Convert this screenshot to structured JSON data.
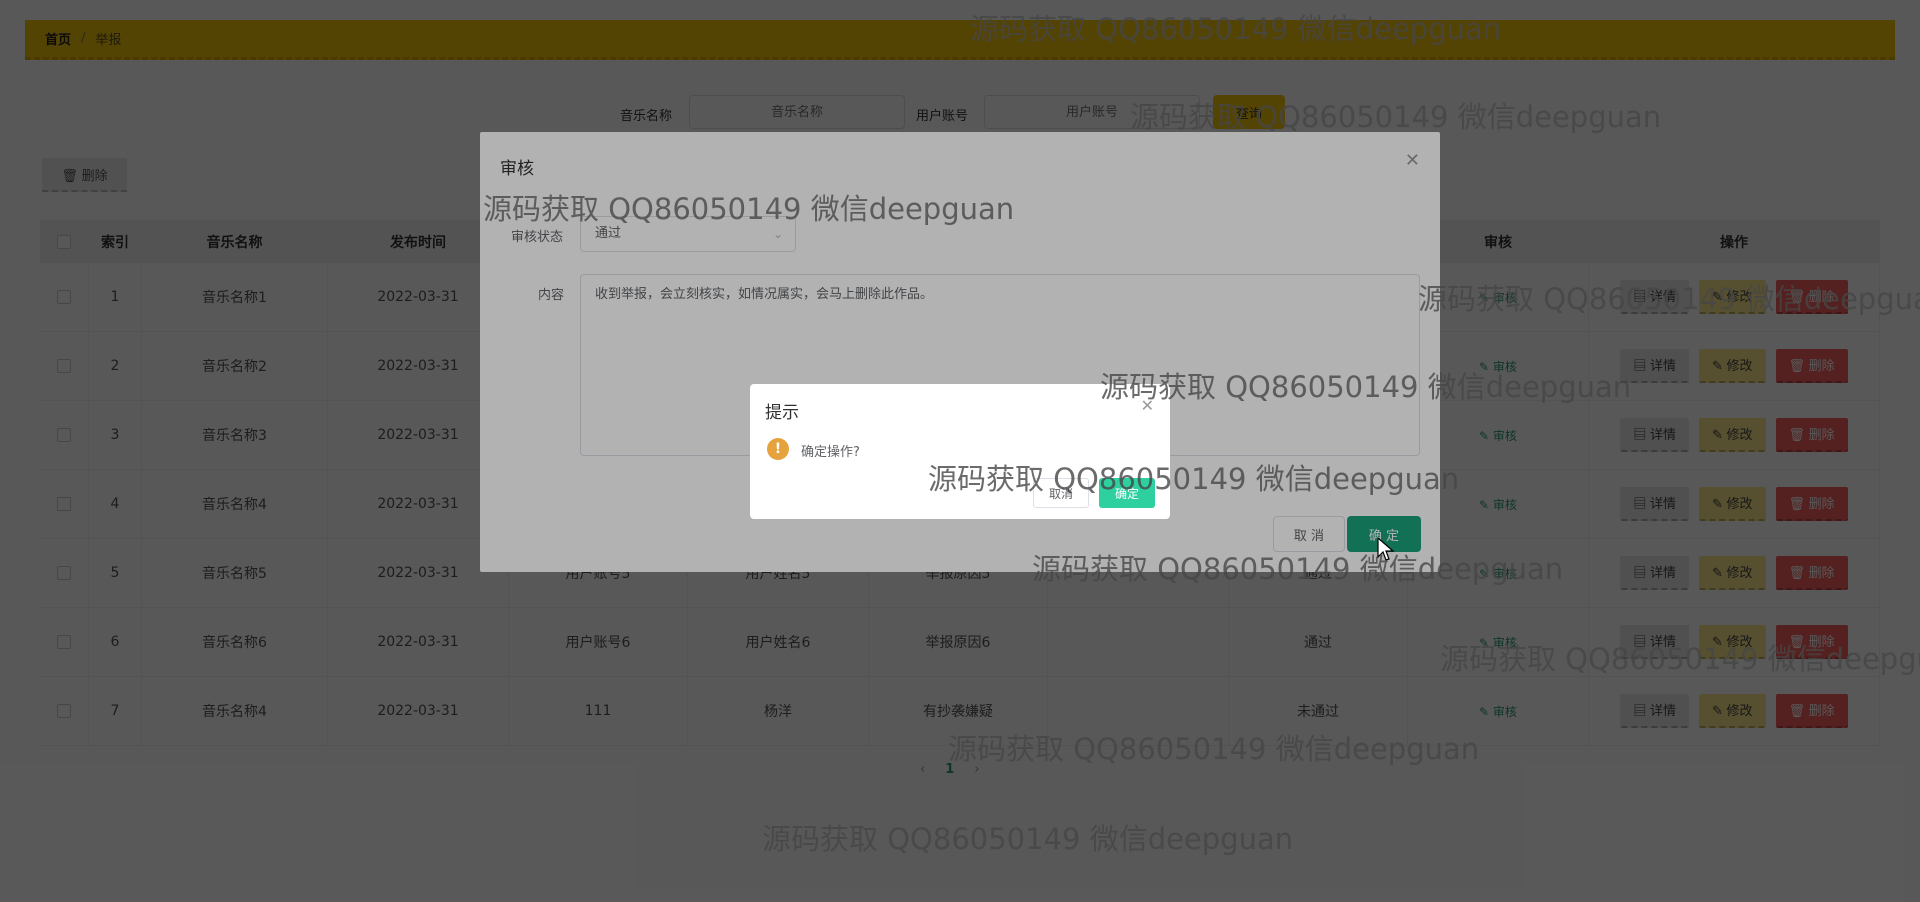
{
  "breadcrumb": {
    "home": "首页",
    "separator": "/",
    "current": "举报"
  },
  "search": {
    "music_label": "音乐名称",
    "music_placeholder": "音乐名称",
    "user_label": "用户账号",
    "user_placeholder": "用户账号",
    "query_button": "查询"
  },
  "toolbar": {
    "delete_label": "删除"
  },
  "table": {
    "columns": [
      "索引",
      "音乐名称",
      "发布时间",
      "",
      "",
      "",
      "",
      "",
      "审核",
      "操作"
    ],
    "rows": [
      {
        "index": "1",
        "music": "音乐名称1",
        "date": "2022-03-31",
        "account": "",
        "name": "",
        "reason": "",
        "reply": "",
        "status": ""
      },
      {
        "index": "2",
        "music": "音乐名称2",
        "date": "2022-03-31",
        "account": "",
        "name": "",
        "reason": "",
        "reply": "",
        "status": ""
      },
      {
        "index": "3",
        "music": "音乐名称3",
        "date": "2022-03-31",
        "account": "",
        "name": "",
        "reason": "",
        "reply": "",
        "status": ""
      },
      {
        "index": "4",
        "music": "音乐名称4",
        "date": "2022-03-31",
        "account": "",
        "name": "",
        "reason": "",
        "reply": "",
        "status": ""
      },
      {
        "index": "5",
        "music": "音乐名称5",
        "date": "2022-03-31",
        "account": "用户账号5",
        "name": "用户姓名5",
        "reason": "举报原因5",
        "reply": "",
        "status": "通过"
      },
      {
        "index": "6",
        "music": "音乐名称6",
        "date": "2022-03-31",
        "account": "用户账号6",
        "name": "用户姓名6",
        "reason": "举报原因6",
        "reply": "",
        "status": "通过"
      },
      {
        "index": "7",
        "music": "音乐名称4",
        "date": "2022-03-31",
        "account": "111",
        "name": "杨洋",
        "reason": "有抄袭嫌疑",
        "reply": "",
        "status": "未通过"
      }
    ],
    "audit_link": "审核",
    "detail_btn": "详情",
    "edit_btn": "修改",
    "delete_btn": "删除"
  },
  "pager": {
    "prev": "‹",
    "current": "1",
    "next": "›"
  },
  "audit_dialog": {
    "title": "审核",
    "status_label": "审核状态",
    "status_value": "通过",
    "content_label": "内容",
    "content_value": "收到举报，会立刻核实，如情况属实，会马上删除此作品。",
    "cancel": "取 消",
    "ok": "确 定"
  },
  "confirm_box": {
    "title": "提示",
    "message": "确定操作?",
    "cancel": "取消",
    "ok": "确定"
  },
  "watermark_text": "源码获取 QQ86050149 微信deepguan",
  "colors": {
    "accent_yellow": "#f2c40c",
    "primary_green": "#1aa37a",
    "danger_red": "#f25f5f",
    "warning": "#e6a23c"
  }
}
